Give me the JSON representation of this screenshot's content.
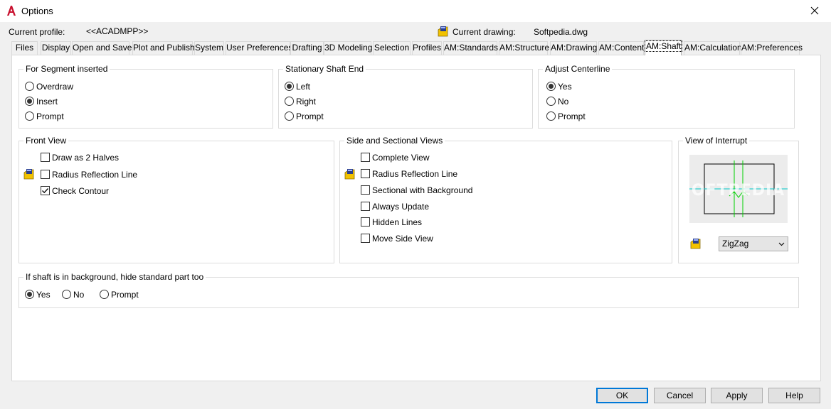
{
  "window": {
    "title": "Options",
    "close_icon": "close-icon"
  },
  "profile": {
    "current_profile_label": "Current profile:",
    "current_profile_value": "<<ACADMPP>>",
    "current_drawing_label": "Current drawing:",
    "current_drawing_value": "Softpedia.dwg"
  },
  "tabs": [
    "Files",
    "Display",
    "Open and Save",
    "Plot and Publish",
    "System",
    "User Preferences",
    "Drafting",
    "3D Modeling",
    "Selection",
    "Profiles",
    "AM:Standards",
    "AM:Structure",
    "AM:Drawing",
    "AM:Content",
    "AM:Shaft",
    "AM:Calculation",
    "AM:Preferences"
  ],
  "active_tab": "AM:Shaft",
  "segment_inserted": {
    "title": "For Segment inserted",
    "options": [
      "Overdraw",
      "Insert",
      "Prompt"
    ],
    "selected": "Insert"
  },
  "stationary_end": {
    "title": "Stationary Shaft End",
    "options": [
      "Left",
      "Right",
      "Prompt"
    ],
    "selected": "Left"
  },
  "adjust_centerline": {
    "title": "Adjust Centerline",
    "options": [
      "Yes",
      "No",
      "Prompt"
    ],
    "selected": "Yes"
  },
  "front_view": {
    "title": "Front View",
    "checks": [
      {
        "label": "Draw as 2 Halves",
        "checked": false
      },
      {
        "label": "Radius Reflection Line",
        "checked": false
      },
      {
        "label": "Check Contour",
        "checked": true
      }
    ]
  },
  "side_views": {
    "title": "Side and Sectional Views",
    "checks": [
      {
        "label": "Complete View",
        "checked": false
      },
      {
        "label": "Radius Reflection Line",
        "checked": false
      },
      {
        "label": "Sectional with Background",
        "checked": false
      },
      {
        "label": "Always Update",
        "checked": false
      },
      {
        "label": "Hidden Lines",
        "checked": false
      },
      {
        "label": "Move Side View",
        "checked": false
      }
    ]
  },
  "interrupt_view": {
    "title": "View of Interrupt",
    "watermark": "SOFTPEDIA",
    "select_value": "ZigZag"
  },
  "background_hide": {
    "title": "If shaft is in background, hide standard part too",
    "options": [
      "Yes",
      "No",
      "Prompt"
    ],
    "selected": "Yes"
  },
  "buttons": {
    "ok": "OK",
    "cancel": "Cancel",
    "apply": "Apply",
    "help": "Help"
  },
  "colors": {
    "accent": "#0078d7",
    "preview_line_green": "#00d000",
    "preview_axis_cyan": "#00c8c8",
    "app_red": "#c8102e"
  }
}
